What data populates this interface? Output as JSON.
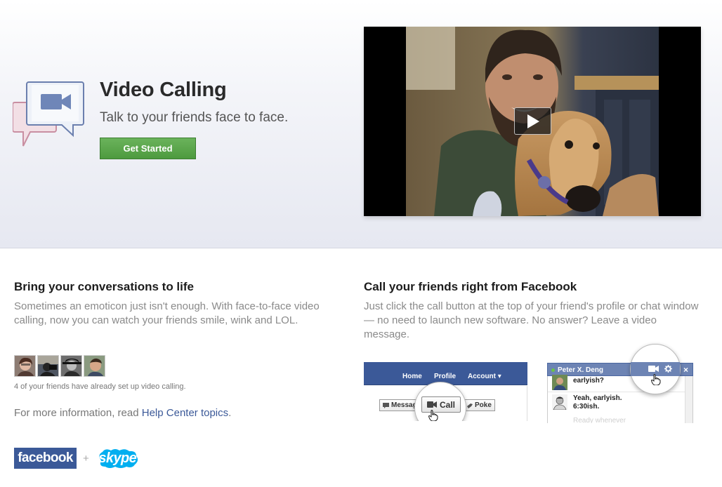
{
  "hero": {
    "title": "Video Calling",
    "subtitle": "Talk to your friends face to face.",
    "cta_label": "Get Started"
  },
  "features": {
    "left": {
      "title": "Bring your conversations to life",
      "text": "Sometimes an emoticon just isn't enough. With face-to-face video calling, now you can watch your friends smile, wink and LOL.",
      "friends_caption": "4 of your friends have already set up video calling.",
      "more_info_prefix": "For more information, read ",
      "more_info_link": "Help Center topics",
      "more_info_suffix": "."
    },
    "right": {
      "title": "Call your friends right from Facebook",
      "text": "Just click the call button at the top of your friend's profile or chat window — no need to launch new software. No answer? Leave a video message."
    }
  },
  "logos": {
    "facebook": "facebook",
    "plus": "+",
    "skype": "skype"
  },
  "profile_mock": {
    "nav": [
      "Home",
      "Profile",
      "Account ▾"
    ],
    "message_label": "Messag",
    "call_label": "Call",
    "poke_label": "Poke"
  },
  "chat_mock": {
    "contact_name": "Peter X. Deng",
    "close": "×",
    "msg1": "earlyish?",
    "msg2_line1": "Yeah, earlyish.",
    "msg2_line2": "6:30ish.",
    "faded": "Ready whenever"
  },
  "colors": {
    "facebook_blue": "#3b5998",
    "chat_header": "#6d84b4",
    "cta_green": "#4d9a3f",
    "skype_blue": "#00aff0",
    "link": "#3b5998"
  },
  "icons": {
    "hero": "video-chat-bubbles-icon",
    "play": "play-icon",
    "camera": "video-camera-icon",
    "gear": "gear-icon",
    "cursor": "hand-cursor-icon"
  }
}
